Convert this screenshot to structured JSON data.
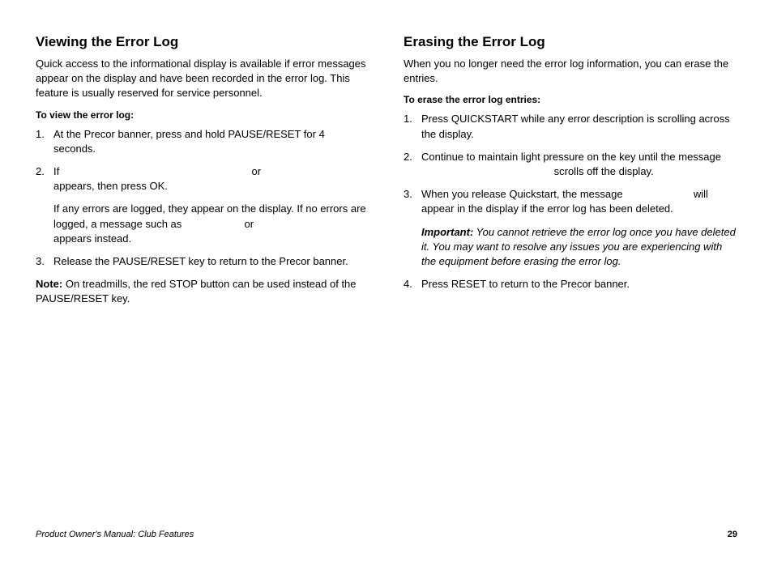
{
  "left": {
    "heading": "Viewing the Error Log",
    "intro": "Quick access to the informational display is available if error messages appear on the display and have been recorded in the error log. This feature is usually reserved for service personnel.",
    "sub_heading": "To view the error log:",
    "step1": "At the Precor banner, press and hold PAUSE/RESET for 4 seconds.",
    "step2_a": "If",
    "step2_b": "or",
    "step2_c": "appears, then press OK.",
    "step2_sub_a": "If any errors are logged, they appear on the display. If no errors are logged, a message such as",
    "step2_sub_b": "or",
    "step2_sub_c": "appears instead.",
    "step3": "Release the PAUSE/RESET key to return to the Precor banner.",
    "note_label": "Note:",
    "note_text": " On treadmills, the red STOP button can be used instead of the PAUSE/RESET key."
  },
  "right": {
    "heading": "Erasing the Error Log",
    "intro": "When you no longer need the error log information, you can erase the entries.",
    "sub_heading": "To erase the error log entries:",
    "step1": "Press QUICKSTART while any error description is scrolling across the display.",
    "step2_a": "Continue to maintain light pressure on the key until the message",
    "step2_b": "scrolls off the display.",
    "step3_a": "When you release Quickstart, the message",
    "step3_b": "will appear in the display if the error log has been deleted.",
    "important_label": "Important:",
    "important_text": " You cannot retrieve the error log once you have deleted it. You may want to resolve any issues you are experiencing with the equipment before erasing the error log.",
    "step4": "Press RESET to return to the Precor banner."
  },
  "footer": {
    "left": "Product Owner's Manual: Club Features",
    "page": "29"
  }
}
